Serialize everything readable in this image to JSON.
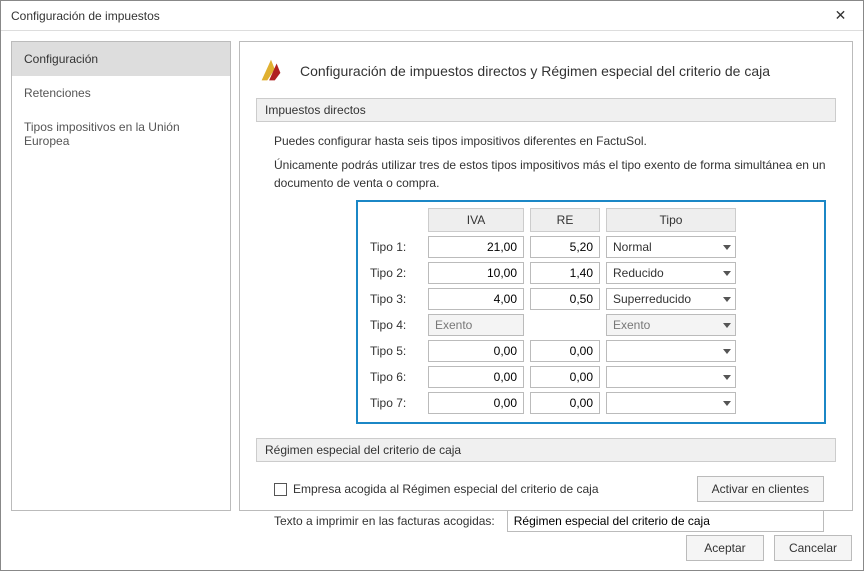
{
  "window": {
    "title": "Configuración de impuestos"
  },
  "sidebar": {
    "items": [
      {
        "label": "Configuración",
        "selected": true
      },
      {
        "label": "Retenciones",
        "selected": false
      },
      {
        "label": "Tipos impositivos en la Unión Europea",
        "selected": false
      }
    ]
  },
  "page": {
    "title": "Configuración de impuestos directos y Régimen especial del criterio de caja"
  },
  "impuestos": {
    "section_title": "Impuestos directos",
    "intro1": "Puedes configurar hasta seis tipos impositivos diferentes en FactuSol.",
    "intro2": "Únicamente podrás utilizar tres de estos tipos impositivos más el tipo exento de forma simultánea en un documento de venta o compra.",
    "headers": {
      "iva": "IVA",
      "re": "RE",
      "tipo": "Tipo"
    },
    "rows": [
      {
        "label": "Tipo 1:",
        "iva": "21,00",
        "re": "5,20",
        "tipo": "Normal",
        "exempt": false
      },
      {
        "label": "Tipo 2:",
        "iva": "10,00",
        "re": "1,40",
        "tipo": "Reducido",
        "exempt": false
      },
      {
        "label": "Tipo 3:",
        "iva": "4,00",
        "re": "0,50",
        "tipo": "Superreducido",
        "exempt": false
      },
      {
        "label": "Tipo 4:",
        "iva": "Exento",
        "re": "",
        "tipo": "Exento",
        "exempt": true
      },
      {
        "label": "Tipo 5:",
        "iva": "0,00",
        "re": "0,00",
        "tipo": "",
        "exempt": false
      },
      {
        "label": "Tipo 6:",
        "iva": "0,00",
        "re": "0,00",
        "tipo": "",
        "exempt": false
      },
      {
        "label": "Tipo 7:",
        "iva": "0,00",
        "re": "0,00",
        "tipo": "",
        "exempt": false
      }
    ]
  },
  "regimen": {
    "section_title": "Régimen especial del criterio de caja",
    "checkbox_label": "Empresa acogida al Régimen especial del criterio de caja",
    "activar_btn": "Activar en clientes",
    "texto_label": "Texto a imprimir en las facturas acogidas:",
    "texto_value": "Régimen especial del criterio de caja"
  },
  "footer": {
    "ok": "Aceptar",
    "cancel": "Cancelar"
  }
}
